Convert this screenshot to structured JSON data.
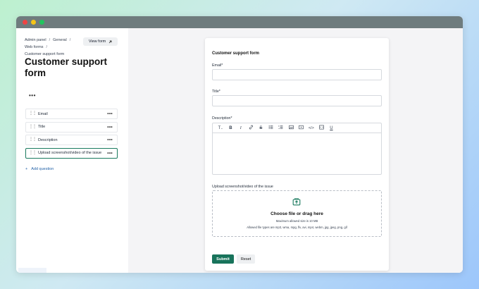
{
  "window": {
    "dot_colors": [
      "#ef4444",
      "#f5c518",
      "#22c55e"
    ]
  },
  "sidebar": {
    "breadcrumbs": [
      "Admin panel",
      "General",
      "Web forms",
      "Customer support form"
    ],
    "view_form_label": "View form",
    "page_title": "Customer support form",
    "more_label": "•••",
    "questions": [
      {
        "label": "Email"
      },
      {
        "label": "Title"
      },
      {
        "label": "Description"
      },
      {
        "label": "Upload screenshot/video of the issue"
      }
    ],
    "add_question_label": "Add question"
  },
  "form": {
    "title": "Customer support form",
    "email_label": "Email*",
    "title_label": "Title*",
    "description_label": "Description*",
    "upload_label": "Upload screenshot/video of the issue",
    "upload_title": "Choose file or drag here",
    "upload_size": "Maximum allowed size is 10 MB",
    "upload_types": "Allowed file types are mp3, wma, mpg, flv, avi, mp4, webm, jpg, jpeg, png, gif",
    "submit_label": "Submit",
    "reset_label": "Reset"
  },
  "colors": {
    "accent": "#18735b",
    "active_border": "#1a7a5e",
    "link": "#2563a8"
  }
}
